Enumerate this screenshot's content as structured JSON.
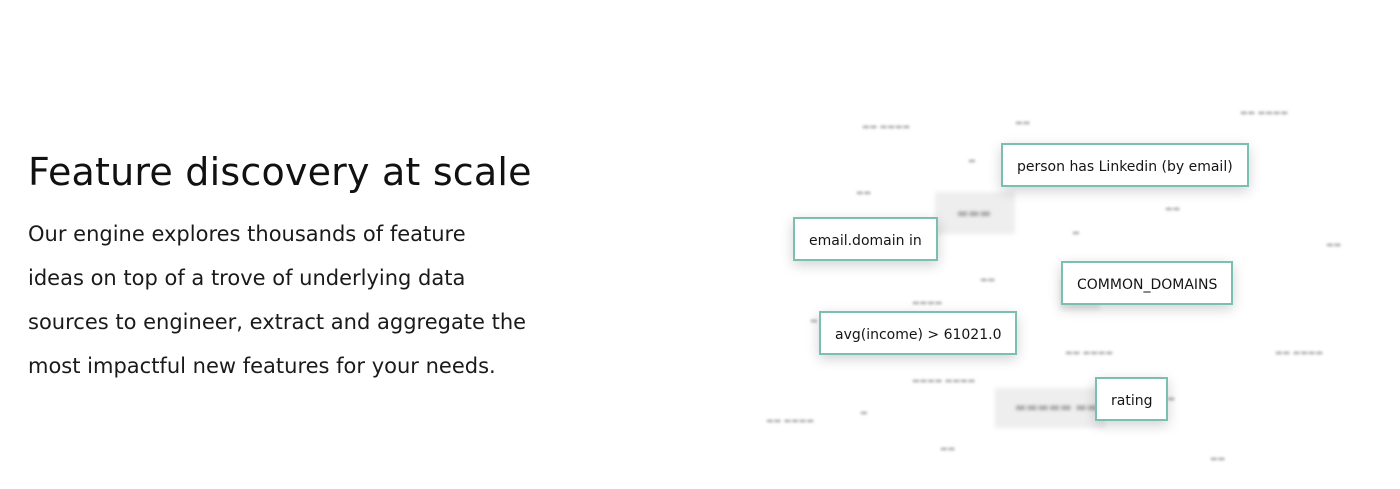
{
  "heading": "Feature discovery at scale",
  "description": "Our engine explores thousands of feature ideas on top of a trove of underlying data sources to engineer, extract and aggregate the most impactful new features for your needs.",
  "feature_chips": [
    "person has Linkedin (by email)",
    "email.domain in",
    "COMMON_DOMAINS",
    "avg(income) > 61021.0",
    "rating"
  ],
  "accent_color": "#7bbfb1"
}
